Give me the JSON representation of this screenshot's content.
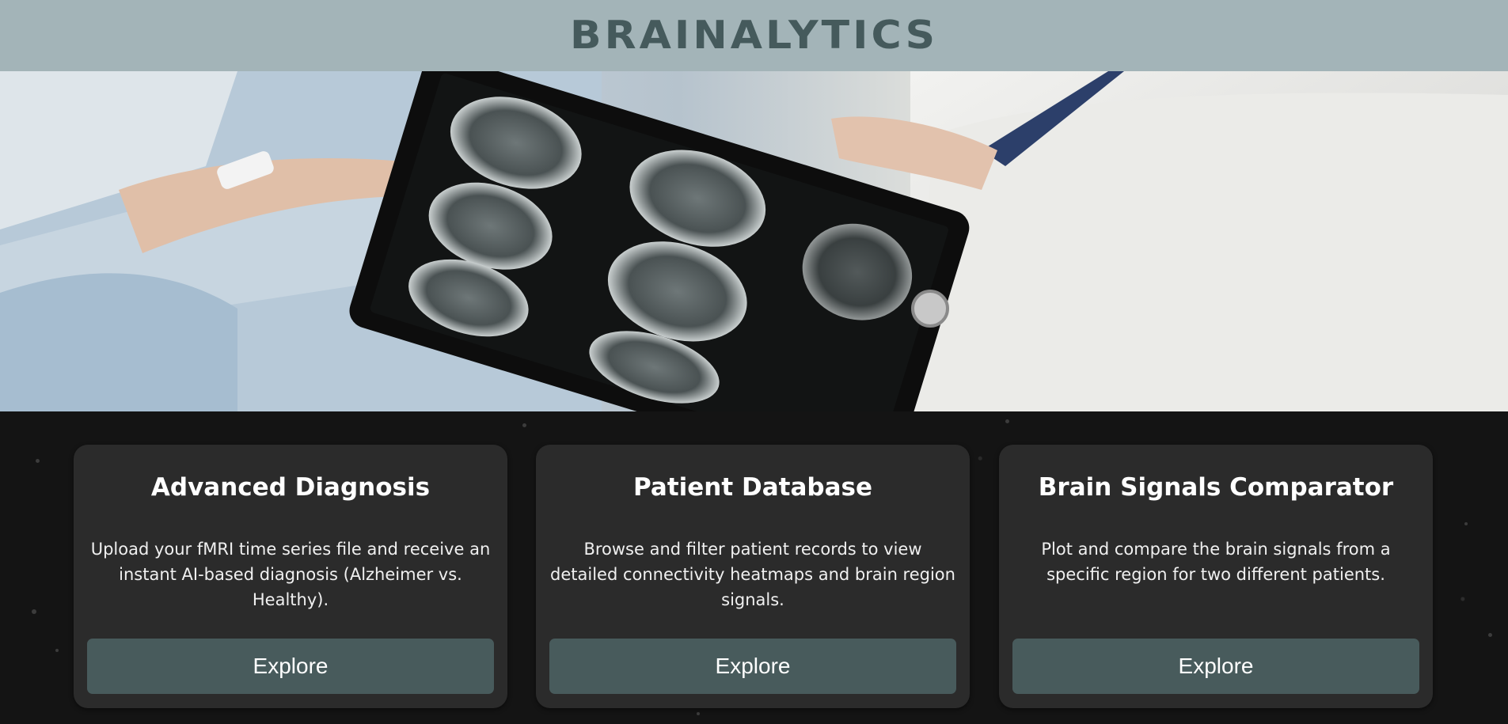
{
  "header": {
    "logo_text": "BRAINALYTICS"
  },
  "hero": {
    "image_description_icon": "doctor-tablet-brain-scan-image"
  },
  "cards": [
    {
      "title": "Advanced Diagnosis",
      "description": "Upload your fMRI time series file and receive an instant AI-based diagnosis (Alzheimer vs. Healthy).",
      "button_label": "Explore"
    },
    {
      "title": "Patient Database",
      "description": "Browse and filter patient records to view detailed connectivity heatmaps and brain region signals.",
      "button_label": "Explore"
    },
    {
      "title": "Brain Signals Comparator",
      "description": "Plot and compare the brain signals from a specific region for two different patients.",
      "button_label": "Explore"
    }
  ],
  "colors": {
    "header_bg": "#a3b4b8",
    "logo": "#455a5c",
    "card_bg": "#2b2b2b",
    "button_bg": "#485b5c",
    "page_bg": "#141414"
  }
}
